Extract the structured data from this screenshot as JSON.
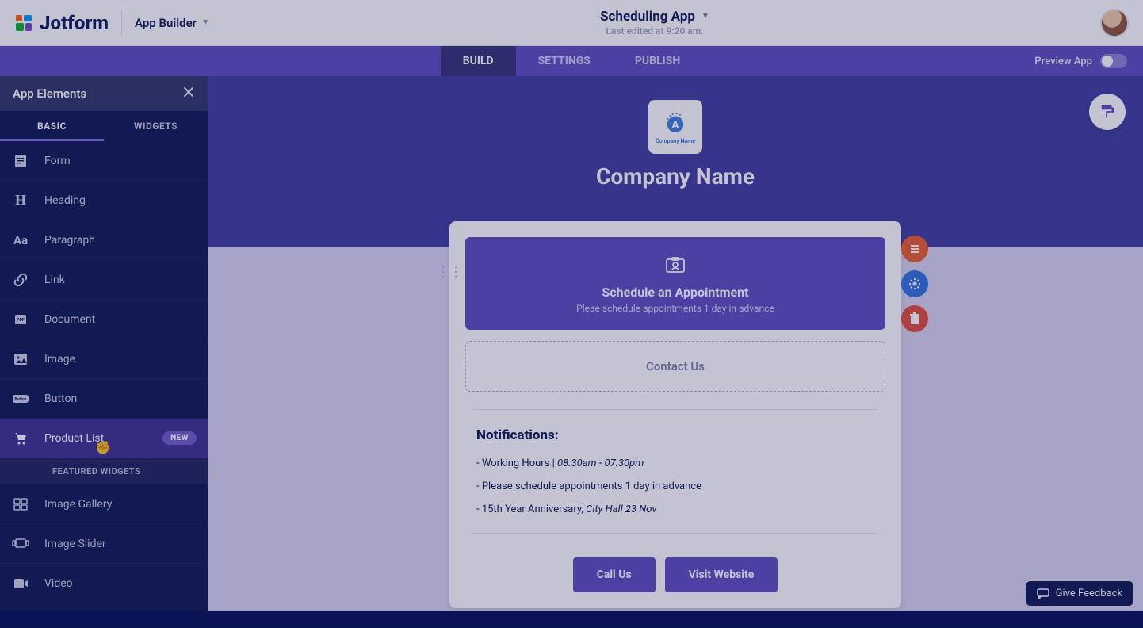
{
  "header": {
    "product_name": "Jotform",
    "section": "App Builder",
    "app_title": "Scheduling App",
    "last_edited": "Last edited at 9:20 am."
  },
  "tabs": {
    "build": "BUILD",
    "settings": "SETTINGS",
    "publish": "PUBLISH",
    "preview_label": "Preview App"
  },
  "sidebar": {
    "title": "App Elements",
    "tab_basic": "BASIC",
    "tab_widgets": "WIDGETS",
    "featured_label": "FEATURED WIDGETS",
    "new_badge": "NEW",
    "items": {
      "form": "Form",
      "heading": "Heading",
      "paragraph": "Paragraph",
      "link": "Link",
      "document": "Document",
      "image": "Image",
      "button": "Button",
      "product_list": "Product List",
      "image_gallery": "Image Gallery",
      "image_slider": "Image Slider",
      "video": "Video"
    }
  },
  "canvas": {
    "logo_sub": "Company Name",
    "company": "Company Name",
    "appt_title": "Schedule an Appointment",
    "appt_sub": "Pleae schedule appointments 1 day in advance",
    "contact_label": "Contact Us",
    "notif_heading": "Notifications:",
    "notif1_a": "- Working Hours | ",
    "notif1_b": "08.30am - 07.30pm",
    "notif2": "- Please schedule appointments 1 day in advance",
    "notif3_a": "- 15th Year Anniversary, ",
    "notif3_b": "City Hall 23 Nov",
    "call_label": "Call Us",
    "visit_label": "Visit Website"
  },
  "feedback": "Give Feedback"
}
